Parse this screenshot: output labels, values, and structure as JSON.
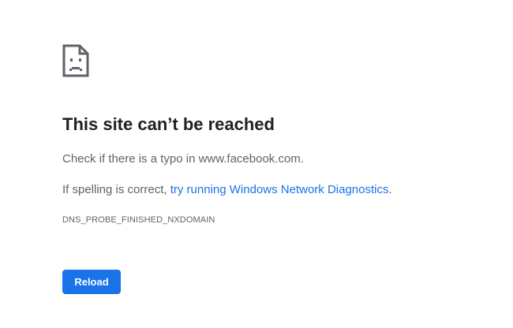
{
  "error_page": {
    "icon": "sad-page-icon",
    "title": "This site can’t be reached",
    "typo_message": "Check if there is a typo in www.facebook.com.",
    "spelling_prefix": "If spelling is correct, ",
    "diagnostics_link": "try running Windows Network Diagnostics",
    "spelling_suffix": ".",
    "error_code": "DNS_PROBE_FINISHED_NXDOMAIN",
    "reload_label": "Reload"
  },
  "colors": {
    "title": "#202124",
    "text": "#5f6368",
    "link": "#1a73e8",
    "button_bg": "#1a73e8",
    "button_text": "#ffffff",
    "icon_stroke": "#5f6368"
  }
}
